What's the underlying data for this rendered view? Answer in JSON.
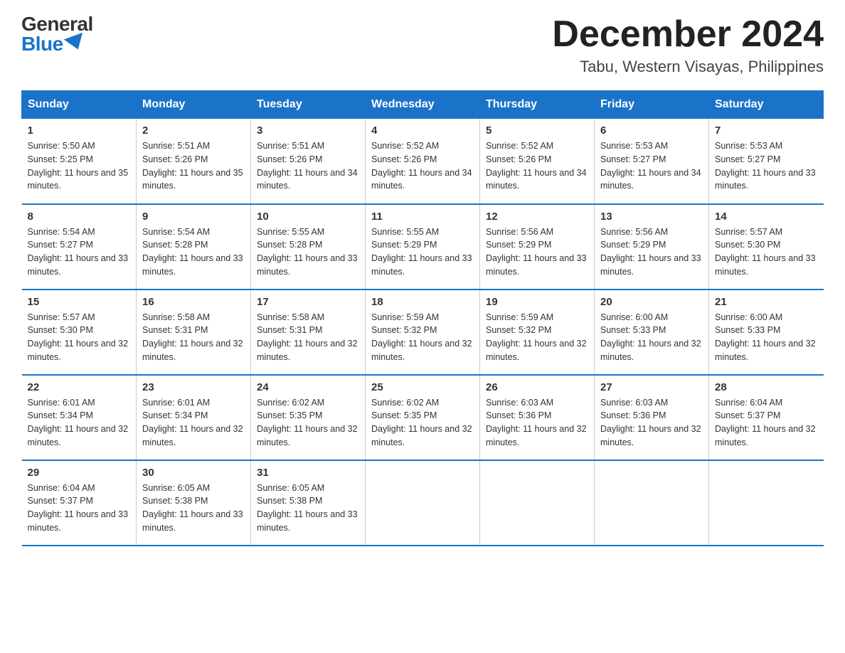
{
  "logo": {
    "general": "General",
    "blue": "Blue"
  },
  "title": "December 2024",
  "location": "Tabu, Western Visayas, Philippines",
  "headers": [
    "Sunday",
    "Monday",
    "Tuesday",
    "Wednesday",
    "Thursday",
    "Friday",
    "Saturday"
  ],
  "weeks": [
    [
      {
        "day": "1",
        "sunrise": "5:50 AM",
        "sunset": "5:25 PM",
        "daylight": "11 hours and 35 minutes."
      },
      {
        "day": "2",
        "sunrise": "5:51 AM",
        "sunset": "5:26 PM",
        "daylight": "11 hours and 35 minutes."
      },
      {
        "day": "3",
        "sunrise": "5:51 AM",
        "sunset": "5:26 PM",
        "daylight": "11 hours and 34 minutes."
      },
      {
        "day": "4",
        "sunrise": "5:52 AM",
        "sunset": "5:26 PM",
        "daylight": "11 hours and 34 minutes."
      },
      {
        "day": "5",
        "sunrise": "5:52 AM",
        "sunset": "5:26 PM",
        "daylight": "11 hours and 34 minutes."
      },
      {
        "day": "6",
        "sunrise": "5:53 AM",
        "sunset": "5:27 PM",
        "daylight": "11 hours and 34 minutes."
      },
      {
        "day": "7",
        "sunrise": "5:53 AM",
        "sunset": "5:27 PM",
        "daylight": "11 hours and 33 minutes."
      }
    ],
    [
      {
        "day": "8",
        "sunrise": "5:54 AM",
        "sunset": "5:27 PM",
        "daylight": "11 hours and 33 minutes."
      },
      {
        "day": "9",
        "sunrise": "5:54 AM",
        "sunset": "5:28 PM",
        "daylight": "11 hours and 33 minutes."
      },
      {
        "day": "10",
        "sunrise": "5:55 AM",
        "sunset": "5:28 PM",
        "daylight": "11 hours and 33 minutes."
      },
      {
        "day": "11",
        "sunrise": "5:55 AM",
        "sunset": "5:29 PM",
        "daylight": "11 hours and 33 minutes."
      },
      {
        "day": "12",
        "sunrise": "5:56 AM",
        "sunset": "5:29 PM",
        "daylight": "11 hours and 33 minutes."
      },
      {
        "day": "13",
        "sunrise": "5:56 AM",
        "sunset": "5:29 PM",
        "daylight": "11 hours and 33 minutes."
      },
      {
        "day": "14",
        "sunrise": "5:57 AM",
        "sunset": "5:30 PM",
        "daylight": "11 hours and 33 minutes."
      }
    ],
    [
      {
        "day": "15",
        "sunrise": "5:57 AM",
        "sunset": "5:30 PM",
        "daylight": "11 hours and 32 minutes."
      },
      {
        "day": "16",
        "sunrise": "5:58 AM",
        "sunset": "5:31 PM",
        "daylight": "11 hours and 32 minutes."
      },
      {
        "day": "17",
        "sunrise": "5:58 AM",
        "sunset": "5:31 PM",
        "daylight": "11 hours and 32 minutes."
      },
      {
        "day": "18",
        "sunrise": "5:59 AM",
        "sunset": "5:32 PM",
        "daylight": "11 hours and 32 minutes."
      },
      {
        "day": "19",
        "sunrise": "5:59 AM",
        "sunset": "5:32 PM",
        "daylight": "11 hours and 32 minutes."
      },
      {
        "day": "20",
        "sunrise": "6:00 AM",
        "sunset": "5:33 PM",
        "daylight": "11 hours and 32 minutes."
      },
      {
        "day": "21",
        "sunrise": "6:00 AM",
        "sunset": "5:33 PM",
        "daylight": "11 hours and 32 minutes."
      }
    ],
    [
      {
        "day": "22",
        "sunrise": "6:01 AM",
        "sunset": "5:34 PM",
        "daylight": "11 hours and 32 minutes."
      },
      {
        "day": "23",
        "sunrise": "6:01 AM",
        "sunset": "5:34 PM",
        "daylight": "11 hours and 32 minutes."
      },
      {
        "day": "24",
        "sunrise": "6:02 AM",
        "sunset": "5:35 PM",
        "daylight": "11 hours and 32 minutes."
      },
      {
        "day": "25",
        "sunrise": "6:02 AM",
        "sunset": "5:35 PM",
        "daylight": "11 hours and 32 minutes."
      },
      {
        "day": "26",
        "sunrise": "6:03 AM",
        "sunset": "5:36 PM",
        "daylight": "11 hours and 32 minutes."
      },
      {
        "day": "27",
        "sunrise": "6:03 AM",
        "sunset": "5:36 PM",
        "daylight": "11 hours and 32 minutes."
      },
      {
        "day": "28",
        "sunrise": "6:04 AM",
        "sunset": "5:37 PM",
        "daylight": "11 hours and 32 minutes."
      }
    ],
    [
      {
        "day": "29",
        "sunrise": "6:04 AM",
        "sunset": "5:37 PM",
        "daylight": "11 hours and 33 minutes."
      },
      {
        "day": "30",
        "sunrise": "6:05 AM",
        "sunset": "5:38 PM",
        "daylight": "11 hours and 33 minutes."
      },
      {
        "day": "31",
        "sunrise": "6:05 AM",
        "sunset": "5:38 PM",
        "daylight": "11 hours and 33 minutes."
      },
      null,
      null,
      null,
      null
    ]
  ]
}
